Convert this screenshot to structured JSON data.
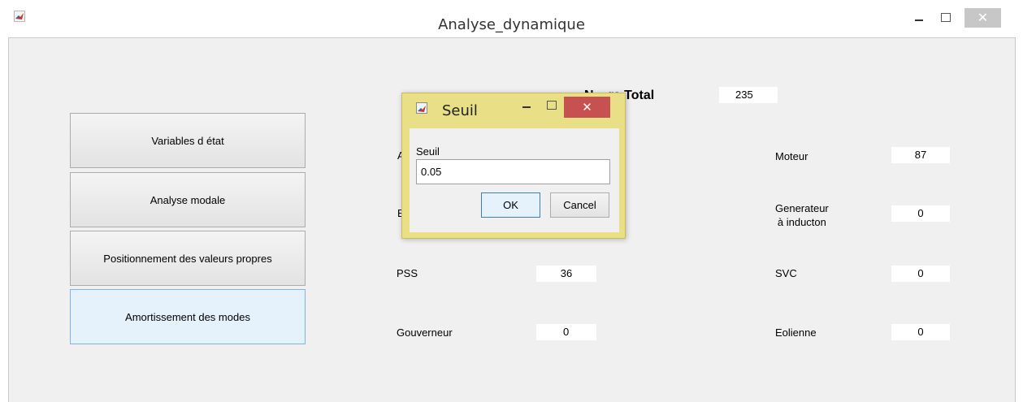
{
  "window": {
    "title": "Analyse_dynamique",
    "close_symbol": "✕"
  },
  "sidebar": {
    "buttons": [
      {
        "label": "Variables d état"
      },
      {
        "label": "Analyse modale"
      },
      {
        "label": "Positionnement des valeurs propres"
      },
      {
        "label": "Amortissement des modes"
      }
    ]
  },
  "main": {
    "total": {
      "label_visible": "N",
      "label_visible_2": "re Total",
      "value": "235"
    },
    "left_labels_partial": [
      "A",
      "E"
    ],
    "pss": {
      "label": "PSS",
      "value": "36"
    },
    "gouverneur": {
      "label": "Gouverneur",
      "value": "0"
    },
    "moteur": {
      "label": "Moteur",
      "value": "87"
    },
    "generateur": {
      "label_line1": "Generateur",
      "label_line2": "à inducton",
      "value": "0"
    },
    "svc": {
      "label": "SVC",
      "value": "0"
    },
    "eolienne": {
      "label": "Eolienne",
      "value": "0"
    }
  },
  "dialog": {
    "title": "Seuil",
    "close_symbol": "✕",
    "field_label": "Seuil",
    "field_value": "0.05",
    "ok_label": "OK",
    "cancel_label": "Cancel",
    "frame_color": "#e8df86",
    "close_color": "#c75050"
  },
  "icons": [
    "matlab-icon",
    "minimize-icon",
    "maximize-icon",
    "close-icon"
  ]
}
